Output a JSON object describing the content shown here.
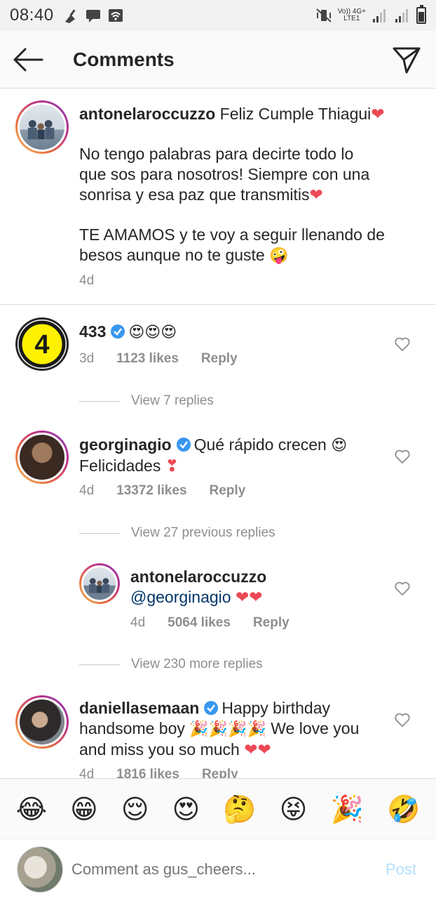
{
  "status": {
    "time": "08:40",
    "net_top": "Vo)) 4G+",
    "net_bottom": "LTE1"
  },
  "header": {
    "title": "Comments"
  },
  "caption": {
    "username": "antonelaroccuzzo",
    "line1": "Feliz Cumple Thiagui",
    "line2": "No tengo palabras para decirte todo lo",
    "line3": "que sos para nosotros! Siempre con una",
    "line4": "sonrisa y esa paz que transmitis",
    "line5": "TE AMAMOS y te voy a seguir llenando de",
    "line6": "besos aunque no te guste",
    "time": "4d"
  },
  "comments": [
    {
      "username": "433",
      "text": "😍😍😍",
      "time": "3d",
      "likes": "1123 likes",
      "reply": "Reply",
      "view_replies": "View 7 replies"
    },
    {
      "username": "georginagio",
      "text": "Qué rápido crecen",
      "text2": "Felicidades",
      "time": "4d",
      "likes": "13372 likes",
      "reply": "Reply",
      "view_replies": "View 27 previous replies"
    },
    {
      "username": "antonelaroccuzzo",
      "mention": "@georginagio",
      "time": "4d",
      "likes": "5064 likes",
      "reply": "Reply",
      "view_replies": "View 230 more replies"
    },
    {
      "username": "daniellasemaan",
      "text": "Happy birthday",
      "text2": "handsome boy",
      "text3": "We love you",
      "text4": "and miss you so much",
      "time": "4d",
      "likes": "1816 likes",
      "reply": "Reply"
    }
  ],
  "emoji_bar": [
    "😂",
    "😁",
    "😌",
    "😍",
    "🤔",
    "😝",
    "🎉",
    "🤣"
  ],
  "compose": {
    "placeholder": "Comment as gus_cheers...",
    "post": "Post"
  },
  "colors": {
    "link": "#0095f6",
    "heart_red": "#ed4956",
    "verified": "#3897f0",
    "post_disabled": "#b2dffc"
  }
}
